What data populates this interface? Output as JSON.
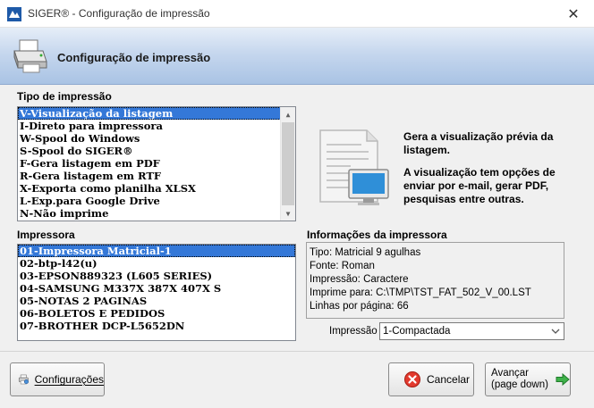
{
  "window": {
    "title": "SIGER® - Configuração de impressão",
    "close_glyph": "✕"
  },
  "header": {
    "title": "Configuração de impressão"
  },
  "print_type": {
    "label": "Tipo de impressão",
    "items": [
      "V-Visualização da listagem",
      "I-Direto para impressora",
      "W-Spool do Windows",
      "S-Spool do SIGER®",
      "F-Gera listagem em PDF",
      "R-Gera listagem em RTF",
      "X-Exporta como planilha XLSX",
      "L-Exp.para Google Drive",
      "N-Não imprime"
    ],
    "selected_index": 0
  },
  "description": {
    "line1": "Gera a visualização prévia da listagem.",
    "line2": "A visualização tem opções de enviar por e-mail, gerar PDF, pesquisas entre outras."
  },
  "printers": {
    "label": "Impressora",
    "items": [
      "01-Impressora Matricial-1",
      "02-btp-l42(u)",
      "03-EPSON889323 (L605 SERIES)",
      "04-SAMSUNG M337X 387X 407X S",
      "05-NOTAS 2 PAGINAS",
      "06-BOLETOS E PEDIDOS",
      "07-BROTHER DCP-L5652DN"
    ],
    "selected_index": 0
  },
  "printer_info": {
    "label": "Informações da impressora",
    "lines": [
      "Tipo: Matricial 9 agulhas",
      "Fonte: Roman",
      "Impressão: Caractere",
      "Imprime para: C:\\TMP\\TST_FAT_502_V_00.LST",
      "Linhas por página: 66"
    ]
  },
  "impressao_combo": {
    "label": "Impressão",
    "value": "1-Compactada"
  },
  "buttons": {
    "config": "Configurações",
    "cancel": "Cancelar",
    "next_line1": "Avançar",
    "next_line2": "(page down)"
  },
  "colors": {
    "selection": "#3478d8",
    "header_gradient_end": "#a9c3e4",
    "app_icon": "#1e5aa8"
  }
}
